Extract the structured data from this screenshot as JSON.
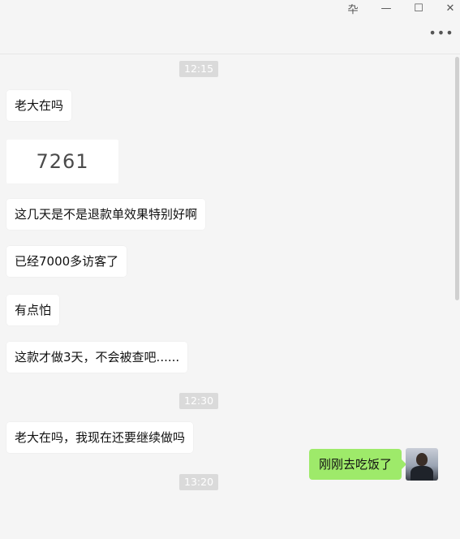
{
  "window": {
    "pin_glyph": "卆",
    "minimize_glyph": "—",
    "maximize_glyph": "☐",
    "close_glyph": "✕",
    "more_glyph": "•••"
  },
  "messages": {
    "time_1": "12:15",
    "msg_1": "老大在吗",
    "msg_number": "7261",
    "msg_2": "这几天是不是退款单效果特别好啊",
    "msg_3": "已经7000多访客了",
    "msg_4": "有点怕",
    "msg_5": "这款才做3天，不会被查吧......",
    "time_2": "12:30",
    "msg_6": "老大在吗，我现在还要继续做吗",
    "time_3": "13:20",
    "my_msg": "刚刚去吃饭了"
  },
  "colors": {
    "background": "#f5f5f5",
    "incoming_bubble": "#ffffff",
    "outgoing_bubble": "#9eea6a",
    "timestamp": "#dadada"
  },
  "icons": {
    "pin": "pin-icon",
    "minimize": "minimize-icon",
    "maximize": "maximize-icon",
    "close": "close-icon",
    "more": "more-icon"
  }
}
